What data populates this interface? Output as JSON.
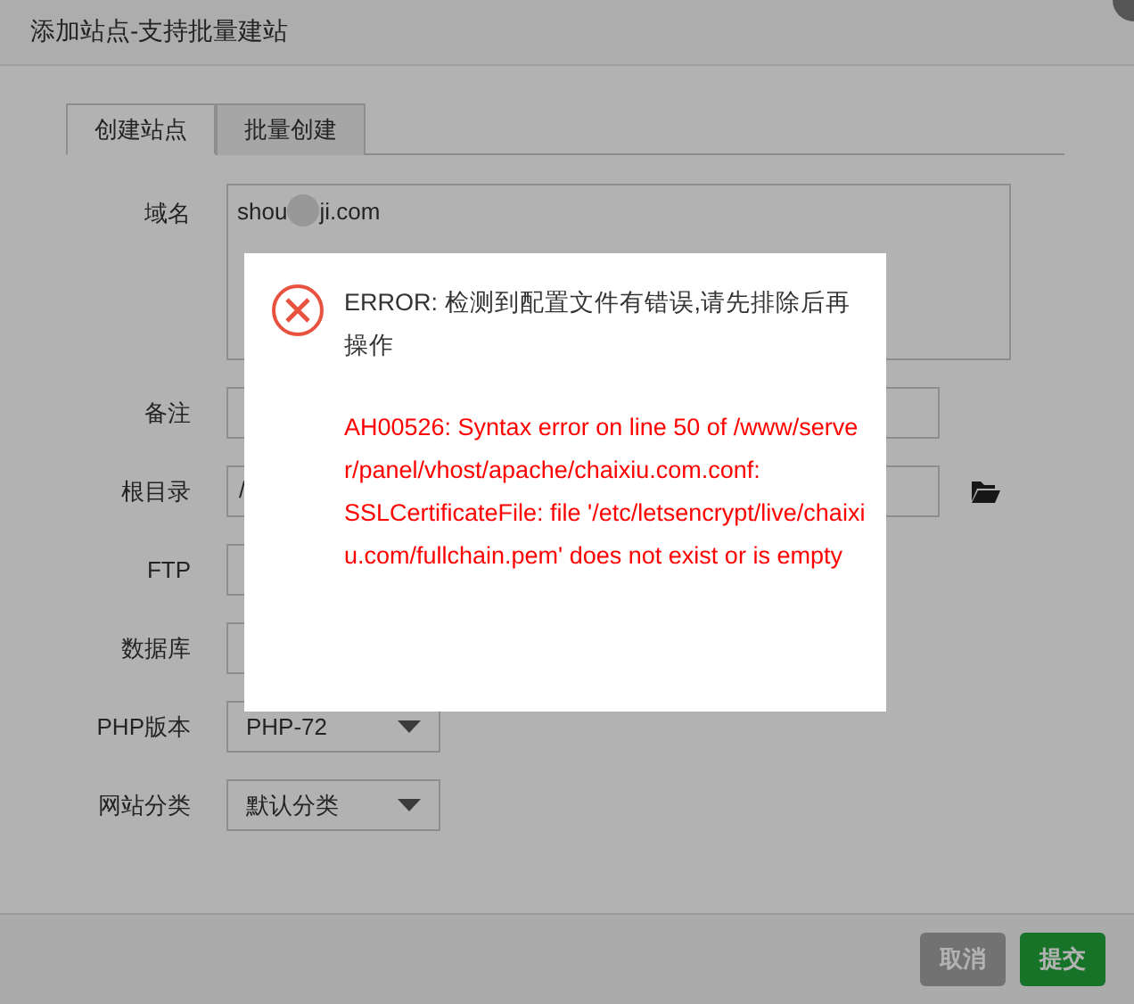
{
  "dialog": {
    "title": "添加站点-支持批量建站"
  },
  "tabs": [
    {
      "label": "创建站点",
      "selected": true
    },
    {
      "label": "批量创建",
      "selected": false
    }
  ],
  "form": [
    {
      "label": "域名",
      "kind": "textarea",
      "value_parts": [
        "shou",
        "ji.com"
      ],
      "redacted": true
    },
    {
      "label": "备注",
      "kind": "input"
    },
    {
      "label": "根目录",
      "kind": "path",
      "value": "/"
    },
    {
      "label": "FTP",
      "kind": "select_hidden"
    },
    {
      "label": "数据库",
      "kind": "select_hidden"
    },
    {
      "label": "PHP版本",
      "kind": "select",
      "value": "PHP-72"
    },
    {
      "label": "网站分类",
      "kind": "select",
      "value": "默认分类"
    }
  ],
  "buttons": [
    {
      "label": "取消",
      "kind": "cancel",
      "disabled": true
    },
    {
      "label": "提交",
      "kind": "submit",
      "disabled": false
    }
  ],
  "error_popup": {
    "heading": "ERROR: 检测到配置文件有错误,请先排除后再操作",
    "detail_lines": [
      "AH00526: Syntax error on line 50 of /www/server/panel/vhost/apache/chaixiu.com.conf:",
      "SSLCertificateFile: file '/etc/letsencrypt/live/chaixiu.com/fullchain.pem' does not exist or is empty"
    ]
  }
}
